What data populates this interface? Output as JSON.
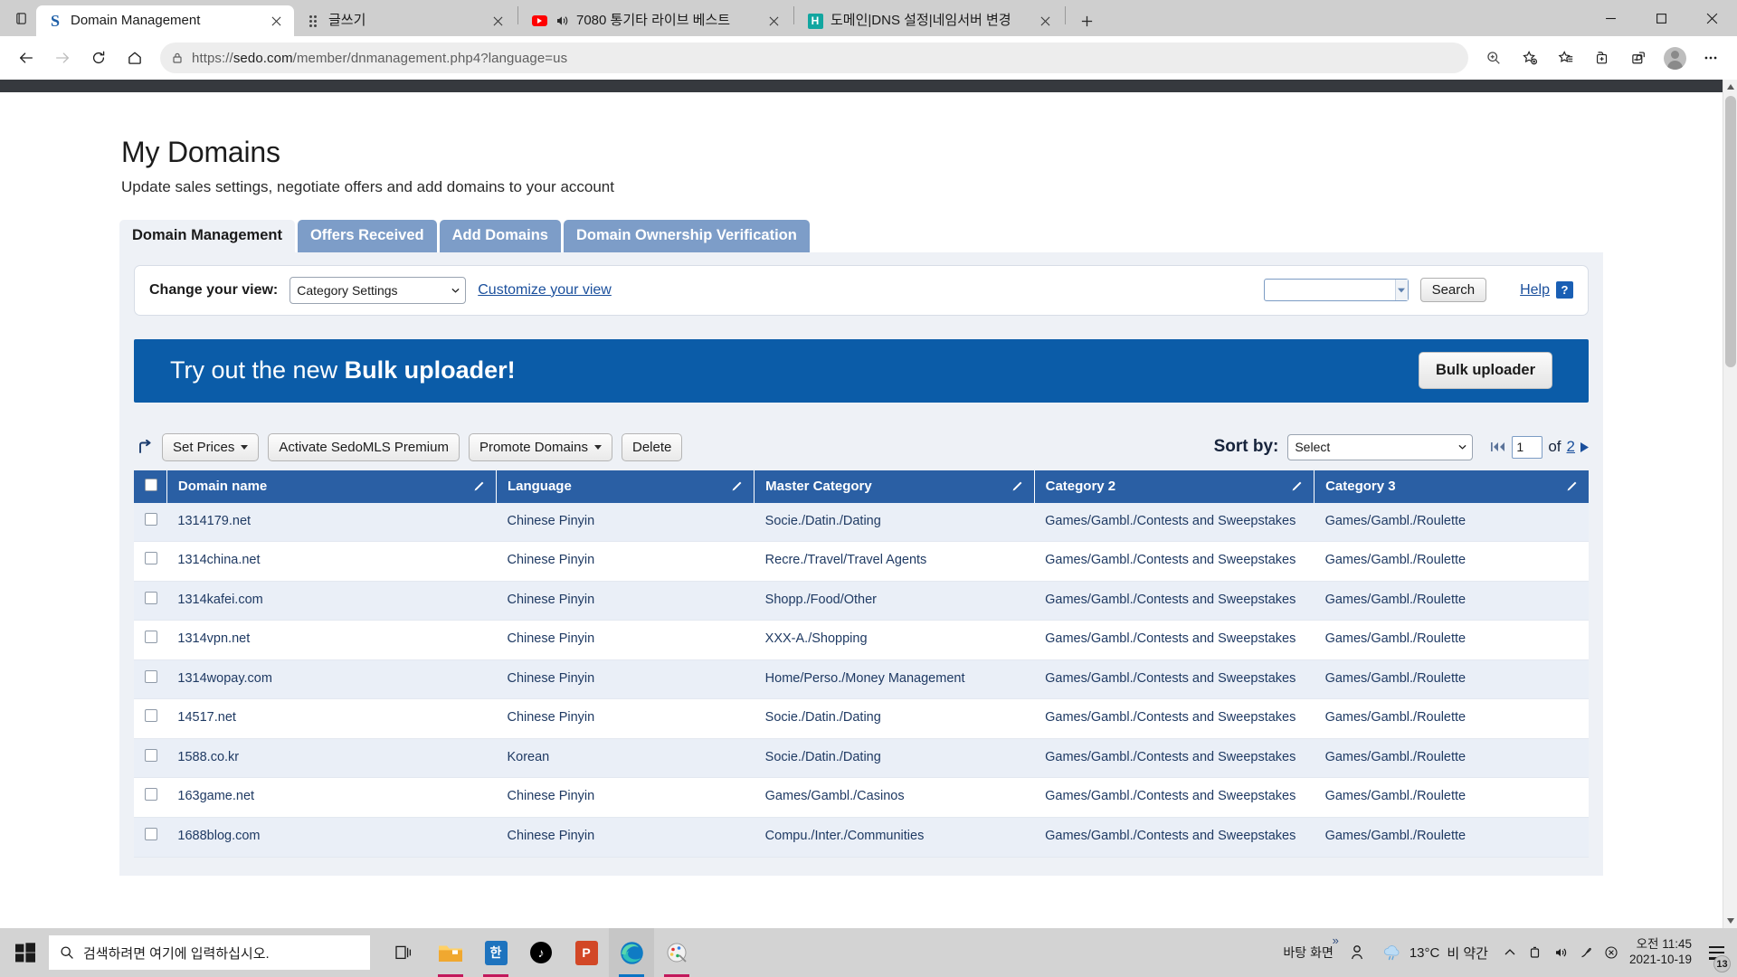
{
  "browser": {
    "tab_list_icon": "tab-list-icon",
    "tabs": [
      {
        "title": "Domain Management",
        "favicon": "sedo-s-icon",
        "active": true
      },
      {
        "title": "글쓰기",
        "favicon": "dots-icon",
        "active": false
      },
      {
        "title": "7080 통기타 라이브 베스트",
        "favicon": "youtube-icon",
        "active": false,
        "audio": true
      },
      {
        "title": "도메인|DNS 설정|네임서버 변경",
        "favicon": "hosting-h-icon",
        "active": false
      }
    ],
    "new_tab_label": "+",
    "window_controls": {
      "minimize": "minimize",
      "maximize": "maximize",
      "close": "close"
    },
    "nav": {
      "back": "back-arrow",
      "forward": "forward-arrow",
      "refresh": "refresh",
      "home": "home"
    },
    "address": {
      "lock": "lock-icon",
      "url_prefix": "https://",
      "url_host": "sedo.com",
      "url_path": "/member/dnmanagement.php4?language=us",
      "url_full": "https://sedo.com/member/dnmanagement.php4?language=us"
    },
    "toolbar_icons": [
      "zoom-icon",
      "add-favorite-icon",
      "favorites-icon",
      "collections-icon",
      "ie-mode-icon",
      "profile-icon",
      "settings-more-icon"
    ]
  },
  "page": {
    "title": "My Domains",
    "subtitle": "Update sales settings, negotiate offers and add domains to your account",
    "tabs": [
      {
        "label": "Domain Management",
        "active": true
      },
      {
        "label": "Offers Received",
        "active": false
      },
      {
        "label": "Add Domains",
        "active": false
      },
      {
        "label": "Domain Ownership Verification",
        "active": false
      }
    ],
    "viewbar": {
      "label": "Change your view:",
      "view_select_value": "Category Settings",
      "customize_link": "Customize your view",
      "search_value": "",
      "search_placeholder": "",
      "search_button": "Search",
      "help_label": "Help",
      "help_badge": "?"
    },
    "banner": {
      "text_light": "Try out the new ",
      "text_bold": "Bulk uploader!",
      "button": "Bulk uploader",
      "color": "#0b5ca8"
    },
    "actions": {
      "set_prices": "Set Prices",
      "activate_premium": "Activate SedoMLS Premium",
      "promote_domains": "Promote Domains",
      "delete": "Delete"
    },
    "sort": {
      "label": "Sort by:",
      "value": "Select"
    },
    "pagination": {
      "current_page": "1",
      "of_label": "of",
      "total_pages": "2"
    },
    "table": {
      "columns": [
        {
          "label": "Domain name",
          "edit": "pencil-icon"
        },
        {
          "label": "Language",
          "edit": "pencil-icon"
        },
        {
          "label": "Master Category",
          "edit": "pencil-icon"
        },
        {
          "label": "Category 2",
          "edit": "pencil-icon"
        },
        {
          "label": "Category 3",
          "edit": "pencil-icon"
        }
      ],
      "rows": [
        {
          "domain": "1314179.net",
          "language": "Chinese Pinyin",
          "master": "Socie./Datin./Dating",
          "cat2": "Games/Gambl./Contests and Sweepstakes",
          "cat3": "Games/Gambl./Roulette"
        },
        {
          "domain": "1314china.net",
          "language": "Chinese Pinyin",
          "master": "Recre./Travel/Travel Agents",
          "cat2": "Games/Gambl./Contests and Sweepstakes",
          "cat3": "Games/Gambl./Roulette"
        },
        {
          "domain": "1314kafei.com",
          "language": "Chinese Pinyin",
          "master": "Shopp./Food/Other",
          "cat2": "Games/Gambl./Contests and Sweepstakes",
          "cat3": "Games/Gambl./Roulette"
        },
        {
          "domain": "1314vpn.net",
          "language": "Chinese Pinyin",
          "master": "XXX-A./Shopping",
          "cat2": "Games/Gambl./Contests and Sweepstakes",
          "cat3": "Games/Gambl./Roulette"
        },
        {
          "domain": "1314wopay.com",
          "language": "Chinese Pinyin",
          "master": "Home/Perso./Money Management",
          "cat2": "Games/Gambl./Contests and Sweepstakes",
          "cat3": "Games/Gambl./Roulette"
        },
        {
          "domain": "14517.net",
          "language": "Chinese Pinyin",
          "master": "Socie./Datin./Dating",
          "cat2": "Games/Gambl./Contests and Sweepstakes",
          "cat3": "Games/Gambl./Roulette"
        },
        {
          "domain": "1588.co.kr",
          "language": "Korean",
          "master": "Socie./Datin./Dating",
          "cat2": "Games/Gambl./Contests and Sweepstakes",
          "cat3": "Games/Gambl./Roulette"
        },
        {
          "domain": "163game.net",
          "language": "Chinese Pinyin",
          "master": "Games/Gambl./Casinos",
          "cat2": "Games/Gambl./Contests and Sweepstakes",
          "cat3": "Games/Gambl./Roulette"
        },
        {
          "domain": "1688blog.com",
          "language": "Chinese Pinyin",
          "master": "Compu./Inter./Communities",
          "cat2": "Games/Gambl./Contests and Sweepstakes",
          "cat3": "Games/Gambl./Roulette"
        }
      ]
    }
  },
  "taskbar": {
    "start": "windows-start-icon",
    "search_placeholder": "검색하려면 여기에 입력하십시오.",
    "apps": [
      {
        "name": "task-view-icon"
      },
      {
        "name": "file-explorer-icon"
      },
      {
        "name": "hangul-icon"
      },
      {
        "name": "tiktok-icon"
      },
      {
        "name": "powerpoint-icon"
      },
      {
        "name": "edge-icon"
      },
      {
        "name": "paint-icon"
      }
    ],
    "tray": {
      "desktop_label": "바탕 화면",
      "overflow": "»",
      "people_icon": "people-icon",
      "weather_temp": "13°C",
      "weather_desc": "비 약간",
      "show_hidden": "chevron-up-icon",
      "battery_icon": "battery-icon",
      "volume_icon": "volume-icon",
      "pen_icon": "pen-icon",
      "close_icon": "close-circle-icon",
      "time": "오전 11:45",
      "date": "2021-10-19",
      "notification_count": "13"
    }
  }
}
